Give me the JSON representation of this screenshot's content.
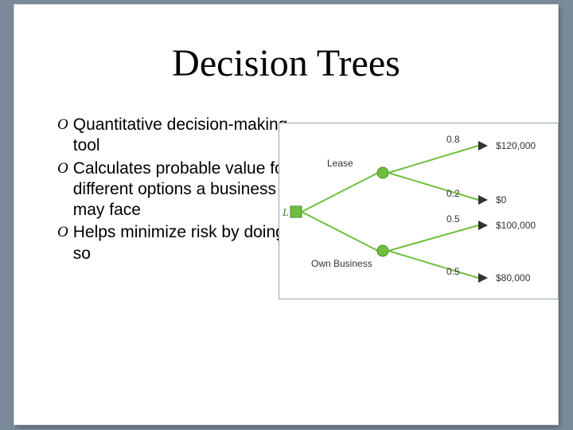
{
  "title": "Decision Trees",
  "bullets": [
    "Quantitative decision-making tool",
    "Calculates probable value for different options a business may face",
    "Helps minimize risk by doing so"
  ],
  "bullet_marker": "O",
  "diagram": {
    "root_label": "L",
    "branches": [
      {
        "label": "Lease",
        "outcomes": [
          {
            "probability": "0.8",
            "payoff": "$120,000"
          },
          {
            "probability": "0.2",
            "payoff": "$0"
          }
        ]
      },
      {
        "label": "Own Business",
        "outcomes": [
          {
            "probability": "0.5",
            "payoff": "$100,000"
          },
          {
            "probability": "0.5",
            "payoff": "$80,000"
          }
        ]
      }
    ]
  },
  "chart_data": {
    "type": "table",
    "decision_label": "L",
    "options": [
      {
        "name": "Lease",
        "outcomes": [
          {
            "probability": 0.8,
            "payoff": 120000
          },
          {
            "probability": 0.2,
            "payoff": 0
          }
        ]
      },
      {
        "name": "Own Business",
        "outcomes": [
          {
            "probability": 0.5,
            "payoff": 100000
          },
          {
            "probability": 0.5,
            "payoff": 80000
          }
        ]
      }
    ]
  }
}
